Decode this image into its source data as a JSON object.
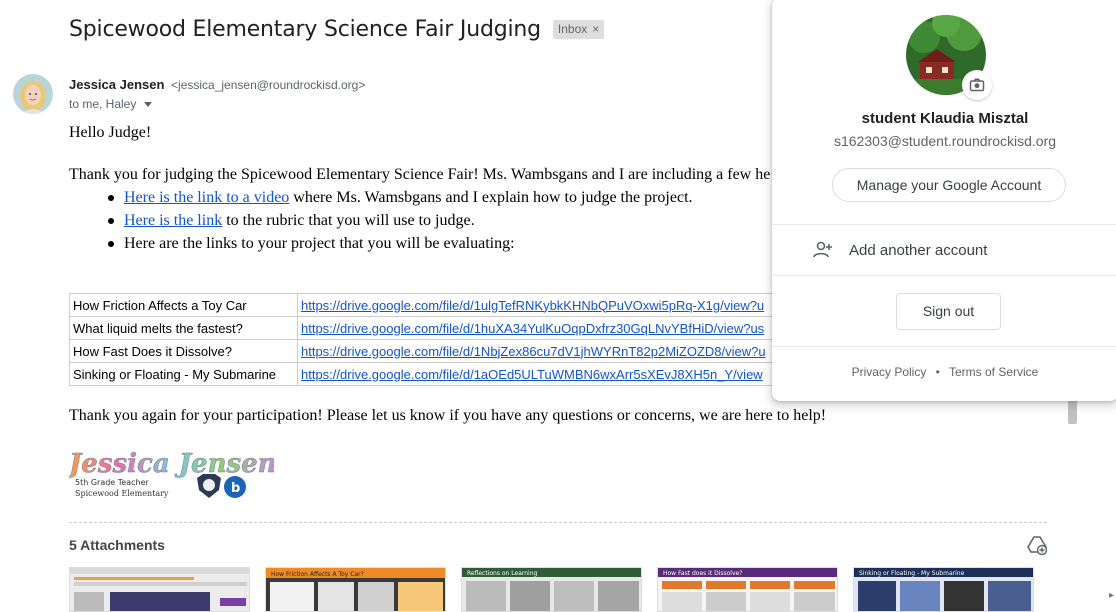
{
  "email": {
    "subject": "Spicewood Elementary Science Fair Judging",
    "label": "Inbox",
    "label_remove": "×",
    "sender_name": "Jessica Jensen",
    "sender_email": "<jessica_jensen@roundrockisd.org>",
    "recipients": "to me, Haley",
    "greeting": "Hello Judge!",
    "intro": "Thank you for judging the Spicewood Elementary Science Fair! Ms. Wambsgans and I are including a few he",
    "bullets": [
      {
        "link": "Here is the link to a video",
        "rest": " where Ms. Wamsbgans and I explain how to judge the project."
      },
      {
        "link": "Here is the link",
        "rest": " to the rubric that you will use to judge."
      },
      {
        "link": "",
        "rest": "Here are the links to your project that you will be evaluating:"
      }
    ],
    "projects": [
      {
        "name": "How Friction Affects a Toy Car",
        "url": "https://drive.google.com/file/d/1ulgTefRNKybkKHNbQPuVOxwi5pRq-X1g/view?u"
      },
      {
        "name": "What liquid melts the fastest?",
        "url": "https://drive.google.com/file/d/1huXA34YulKuOqpDxfrz30GqLNvYBfHiD/view?us"
      },
      {
        "name": "How Fast Does it Dissolve?",
        "url": "https://drive.google.com/file/d/1NbjZex86cu7dV1jhWYRnT82p2MiZOZD8/view?u"
      },
      {
        "name": "Sinking or Floating - My Submarine",
        "url": "https://drive.google.com/file/d/1aOEd5ULTuWMBN6wxArr5sXEvJ8XH5n_Y/view"
      }
    ],
    "closing": "Thank you again for your participation! Please let us know if you have any questions or concerns, we are here to help!",
    "signature": {
      "name": "Jessica Jensen",
      "line1": "5th Grade Teacher",
      "line2": "Spicewood Elementary"
    },
    "attachments_title": "5 Attachments",
    "attachments": [
      {
        "title": ""
      },
      {
        "title": "How Friction Affects A Toy Car?"
      },
      {
        "title": "Reflections on Learning"
      },
      {
        "title": "How Fast does it Dissolve?"
      },
      {
        "title": "Sinking or Floating - My Submarine"
      }
    ]
  },
  "account_popup": {
    "name": "student Klaudia Misztal",
    "email": "s162303@student.roundrockisd.org",
    "manage_label": "Manage your Google Account",
    "add_account_label": "Add another account",
    "sign_out_label": "Sign out",
    "privacy_label": "Privacy Policy",
    "terms_label": "Terms of Service",
    "separator": "•"
  },
  "colors": {
    "link": "#1155cc",
    "text": "#202124",
    "muted": "#5f6368"
  },
  "icons": [
    "camera-icon",
    "add-person-icon",
    "drive-add-icon",
    "chevron-down-icon",
    "close-icon"
  ]
}
